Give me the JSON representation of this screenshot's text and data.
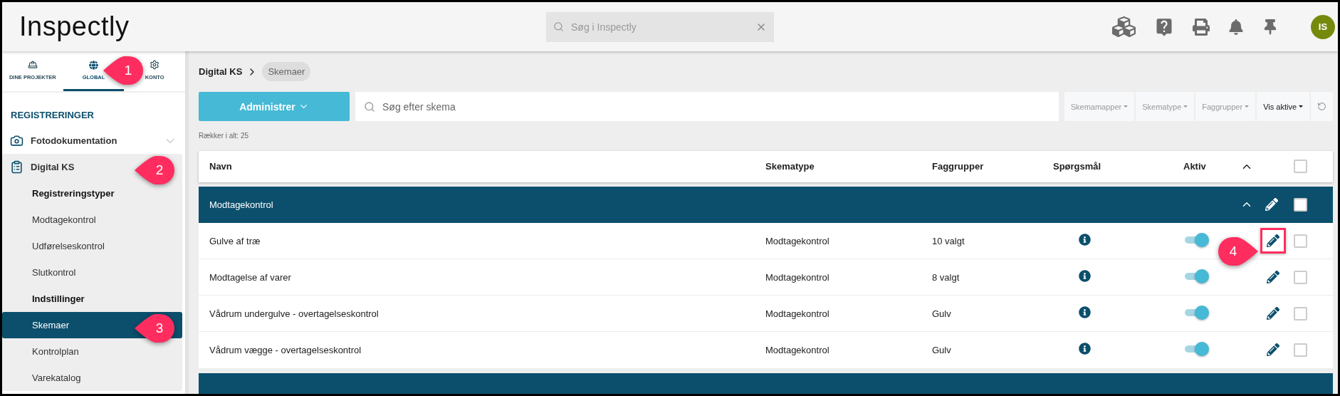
{
  "header": {
    "logo": "Inspectly",
    "search": {
      "placeholder": "Søg i Inspectly"
    },
    "avatar": "IS"
  },
  "sidebar": {
    "tabs": [
      {
        "kind": "projects",
        "label": "DINE PROJEKTER",
        "selected": false
      },
      {
        "kind": "global",
        "label": "GLOBAL",
        "selected": true
      },
      {
        "kind": "account",
        "label": "KONTO",
        "selected": false
      }
    ],
    "section_title": "REGISTRERINGER",
    "items": [
      {
        "kind": "module",
        "label": "Fotodokumentation",
        "expanded": false,
        "selected": false
      },
      {
        "kind": "module",
        "label": "Digital KS",
        "expanded": true,
        "selected": false
      },
      {
        "kind": "heading",
        "label": "Registreringstyper",
        "selected": false
      },
      {
        "kind": "link",
        "label": "Modtagekontrol",
        "selected": false
      },
      {
        "kind": "link",
        "label": "Udførelseskontrol",
        "selected": false
      },
      {
        "kind": "link",
        "label": "Slutkontrol",
        "selected": false
      },
      {
        "kind": "heading",
        "label": "Indstillinger",
        "selected": false
      },
      {
        "kind": "link",
        "label": "Skemaer",
        "selected": true
      },
      {
        "kind": "link",
        "label": "Kontrolplan",
        "selected": false
      },
      {
        "kind": "link",
        "label": "Varekatalog",
        "selected": false
      }
    ]
  },
  "breadcrumb": [
    "Digital KS",
    "Skemaer"
  ],
  "toolbar": {
    "button": "Administrer",
    "search": {
      "placeholder": "Søg efter skema"
    },
    "filters": [
      {
        "label": "Skemamapper",
        "active": false
      },
      {
        "label": "Skematype",
        "active": false
      },
      {
        "label": "Faggrupper",
        "active": false
      },
      {
        "label": "Vis aktive",
        "active": true
      }
    ]
  },
  "row_count": "Rækker i alt: 25",
  "table": {
    "columns": [
      "Navn",
      "Skematype",
      "Faggrupper",
      "Spørgsmål",
      "Aktiv"
    ],
    "all_checked": false,
    "groups": [
      {
        "name": "Modtagekontrol",
        "checked": false,
        "rows": [
          {
            "name": "Gulve af træ",
            "type": "Modtagekontrol",
            "trade_groups": "10 valgt",
            "active": true,
            "checked": false,
            "highlighted": true
          },
          {
            "name": "Modtagelse af varer",
            "type": "Modtagekontrol",
            "trade_groups": "8 valgt",
            "active": true,
            "checked": false,
            "highlighted": false
          },
          {
            "name": "Vådrum undergulve - overtagelseskontrol",
            "type": "Modtagekontrol",
            "trade_groups": "Gulv",
            "active": true,
            "checked": false,
            "highlighted": false
          },
          {
            "name": "Vådrum vægge - overtagelseskontrol",
            "type": "Modtagekontrol",
            "trade_groups": "Gulv",
            "active": true,
            "checked": false,
            "highlighted": false
          }
        ]
      }
    ],
    "more_groups_below": true
  },
  "callouts": [
    {
      "number": "1"
    },
    {
      "number": "2"
    },
    {
      "number": "3"
    },
    {
      "number": "4"
    }
  ]
}
